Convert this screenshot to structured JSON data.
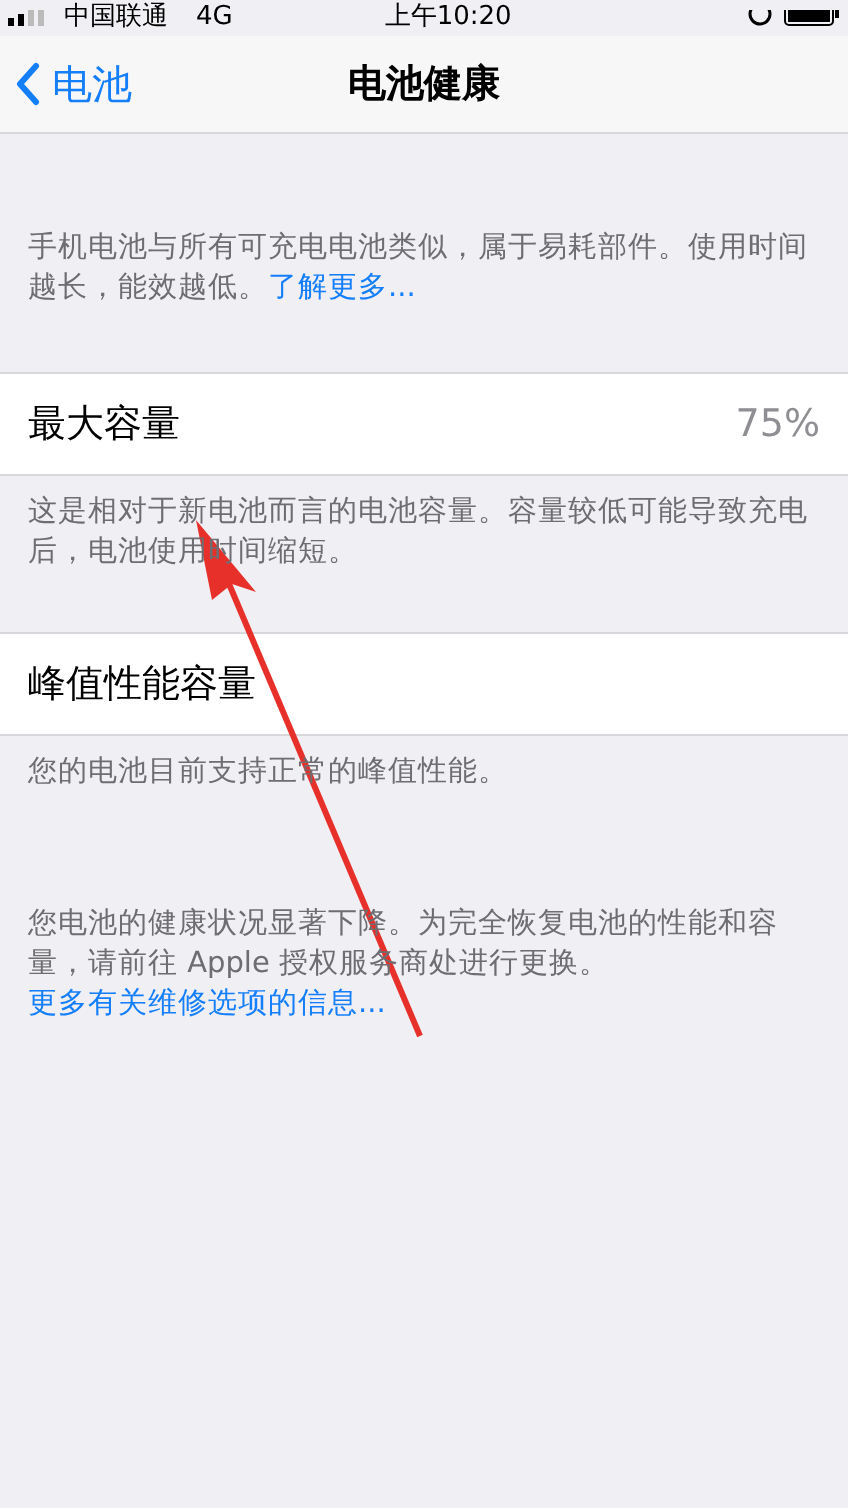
{
  "status_bar": {
    "carrier": "中国联通",
    "network": "4G",
    "time": "上午10:20"
  },
  "nav": {
    "back": "电池",
    "title": "电池健康"
  },
  "intro": {
    "text": "手机电池与所有可充电电池类似，属于易耗部件。使用时间越长，能效越低。",
    "link": "了解更多..."
  },
  "sections": [
    {
      "label": "最大容量",
      "value": "75%",
      "note": "这是相对于新电池而言的电池容量。容量较低可能导致充电后，电池使用时间缩短。"
    },
    {
      "label": "峰值性能容量",
      "note": "您的电池目前支持正常的峰值性能。"
    }
  ],
  "warning": {
    "text": "您电池的健康状况显著下降。为完全恢复电池的性能和容量，请前往 Apple 授权服务商处进行更换。",
    "link": "更多有关维修选项的信息..."
  }
}
